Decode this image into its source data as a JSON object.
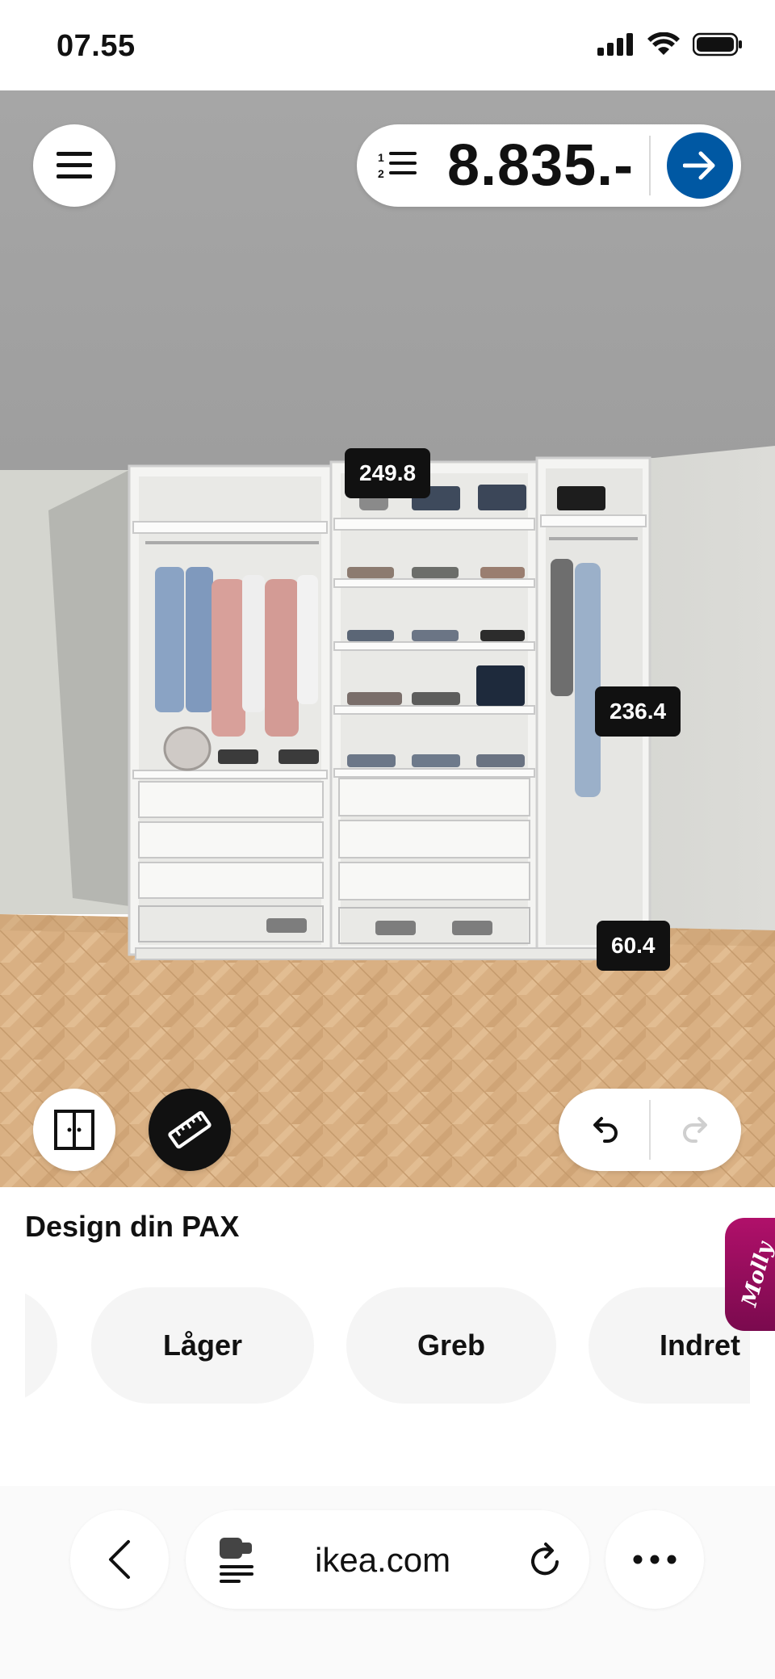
{
  "status": {
    "time": "07.55"
  },
  "toolbar": {
    "price": "8.835.-"
  },
  "dimensions": {
    "top_width": "249.8",
    "height": "236.4",
    "depth": "60.4"
  },
  "panel": {
    "title": "Design din PAX",
    "chips": [
      "Låger",
      "Greb",
      "Indret"
    ]
  },
  "assistant": {
    "label": "Molly"
  },
  "browser": {
    "url": "ikea.com"
  },
  "colors": {
    "brand_blue": "#0058a3",
    "molly_magenta": "#a00f63"
  }
}
